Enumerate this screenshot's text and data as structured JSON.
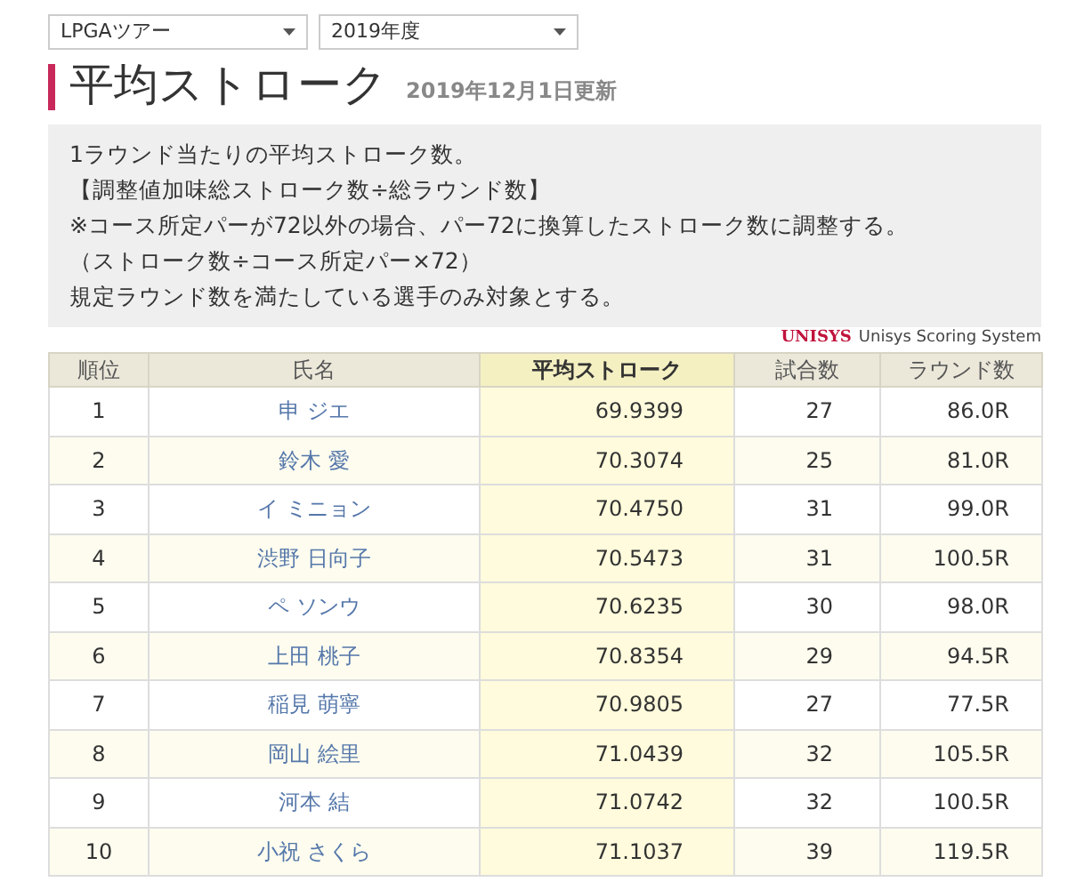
{
  "filters": [
    {
      "value": "LPGAツアー"
    },
    {
      "value": "2019年度"
    }
  ],
  "heading": {
    "title": "平均ストローク",
    "updated": "2019年12月1日更新"
  },
  "notes": [
    "1ラウンド当たりの平均ストローク数。",
    "【調整値加味総ストローク数÷総ラウンド数】",
    "※コース所定パーが72以外の場合、パー72に換算したストローク数に調整する。",
    "（ストローク数÷コース所定パー×72）",
    "規定ラウンド数を満たしている選手のみ対象とする。"
  ],
  "credit": {
    "logo": "UNISYS",
    "text": "Unisys Scoring System"
  },
  "table": {
    "columns": [
      {
        "label": "順位",
        "sorted": false
      },
      {
        "label": "氏名",
        "sorted": false
      },
      {
        "label": "平均ストローク",
        "sorted": true
      },
      {
        "label": "試合数",
        "sorted": false
      },
      {
        "label": "ラウンド数",
        "sorted": false
      }
    ],
    "rows": [
      [
        "1",
        "申 ジエ",
        "69.9399",
        "27",
        "86.0R"
      ],
      [
        "2",
        "鈴木 愛",
        "70.3074",
        "25",
        "81.0R"
      ],
      [
        "3",
        "イ ミニョン",
        "70.4750",
        "31",
        "99.0R"
      ],
      [
        "4",
        "渋野 日向子",
        "70.5473",
        "31",
        "100.5R"
      ],
      [
        "5",
        "ペ ソンウ",
        "70.6235",
        "30",
        "98.0R"
      ],
      [
        "6",
        "上田 桃子",
        "70.8354",
        "29",
        "94.5R"
      ],
      [
        "7",
        "稲見 萌寧",
        "70.9805",
        "27",
        "77.5R"
      ],
      [
        "8",
        "岡山 絵里",
        "71.0439",
        "32",
        "105.5R"
      ],
      [
        "9",
        "河本 結",
        "71.0742",
        "32",
        "100.5R"
      ],
      [
        "10",
        "小祝 さくら",
        "71.1037",
        "39",
        "119.5R"
      ]
    ]
  }
}
